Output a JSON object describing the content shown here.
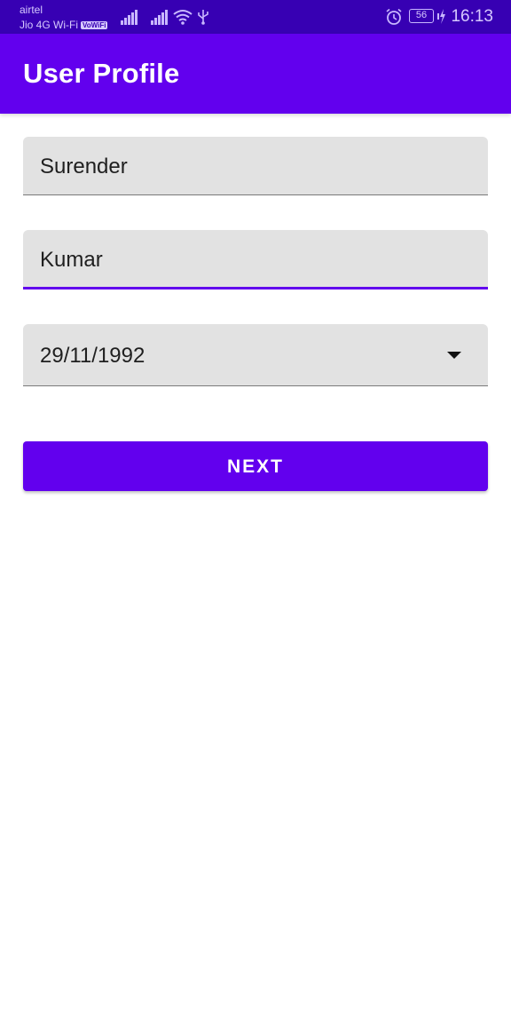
{
  "status_bar": {
    "carrier_primary": "airtel",
    "carrier_secondary": "Jio 4G Wi-Fi",
    "vowifi_badge": "VoWiFi",
    "battery_level": "56",
    "time": "16:13",
    "icons": [
      "signal-icon",
      "signal-icon",
      "wifi-icon",
      "usb-icon",
      "alarm-icon",
      "battery-icon",
      "charging-icon"
    ]
  },
  "app_bar": {
    "title": "User Profile",
    "color": "#6200ee"
  },
  "form": {
    "first_name": {
      "value": "Surender"
    },
    "last_name": {
      "value": "Kumar"
    },
    "date_of_birth": {
      "value": "29/11/1992"
    },
    "next_button_label": "NEXT"
  },
  "colors": {
    "status_bar": "#3700b3",
    "primary": "#6200ee",
    "field_background": "#e2e2e2"
  }
}
